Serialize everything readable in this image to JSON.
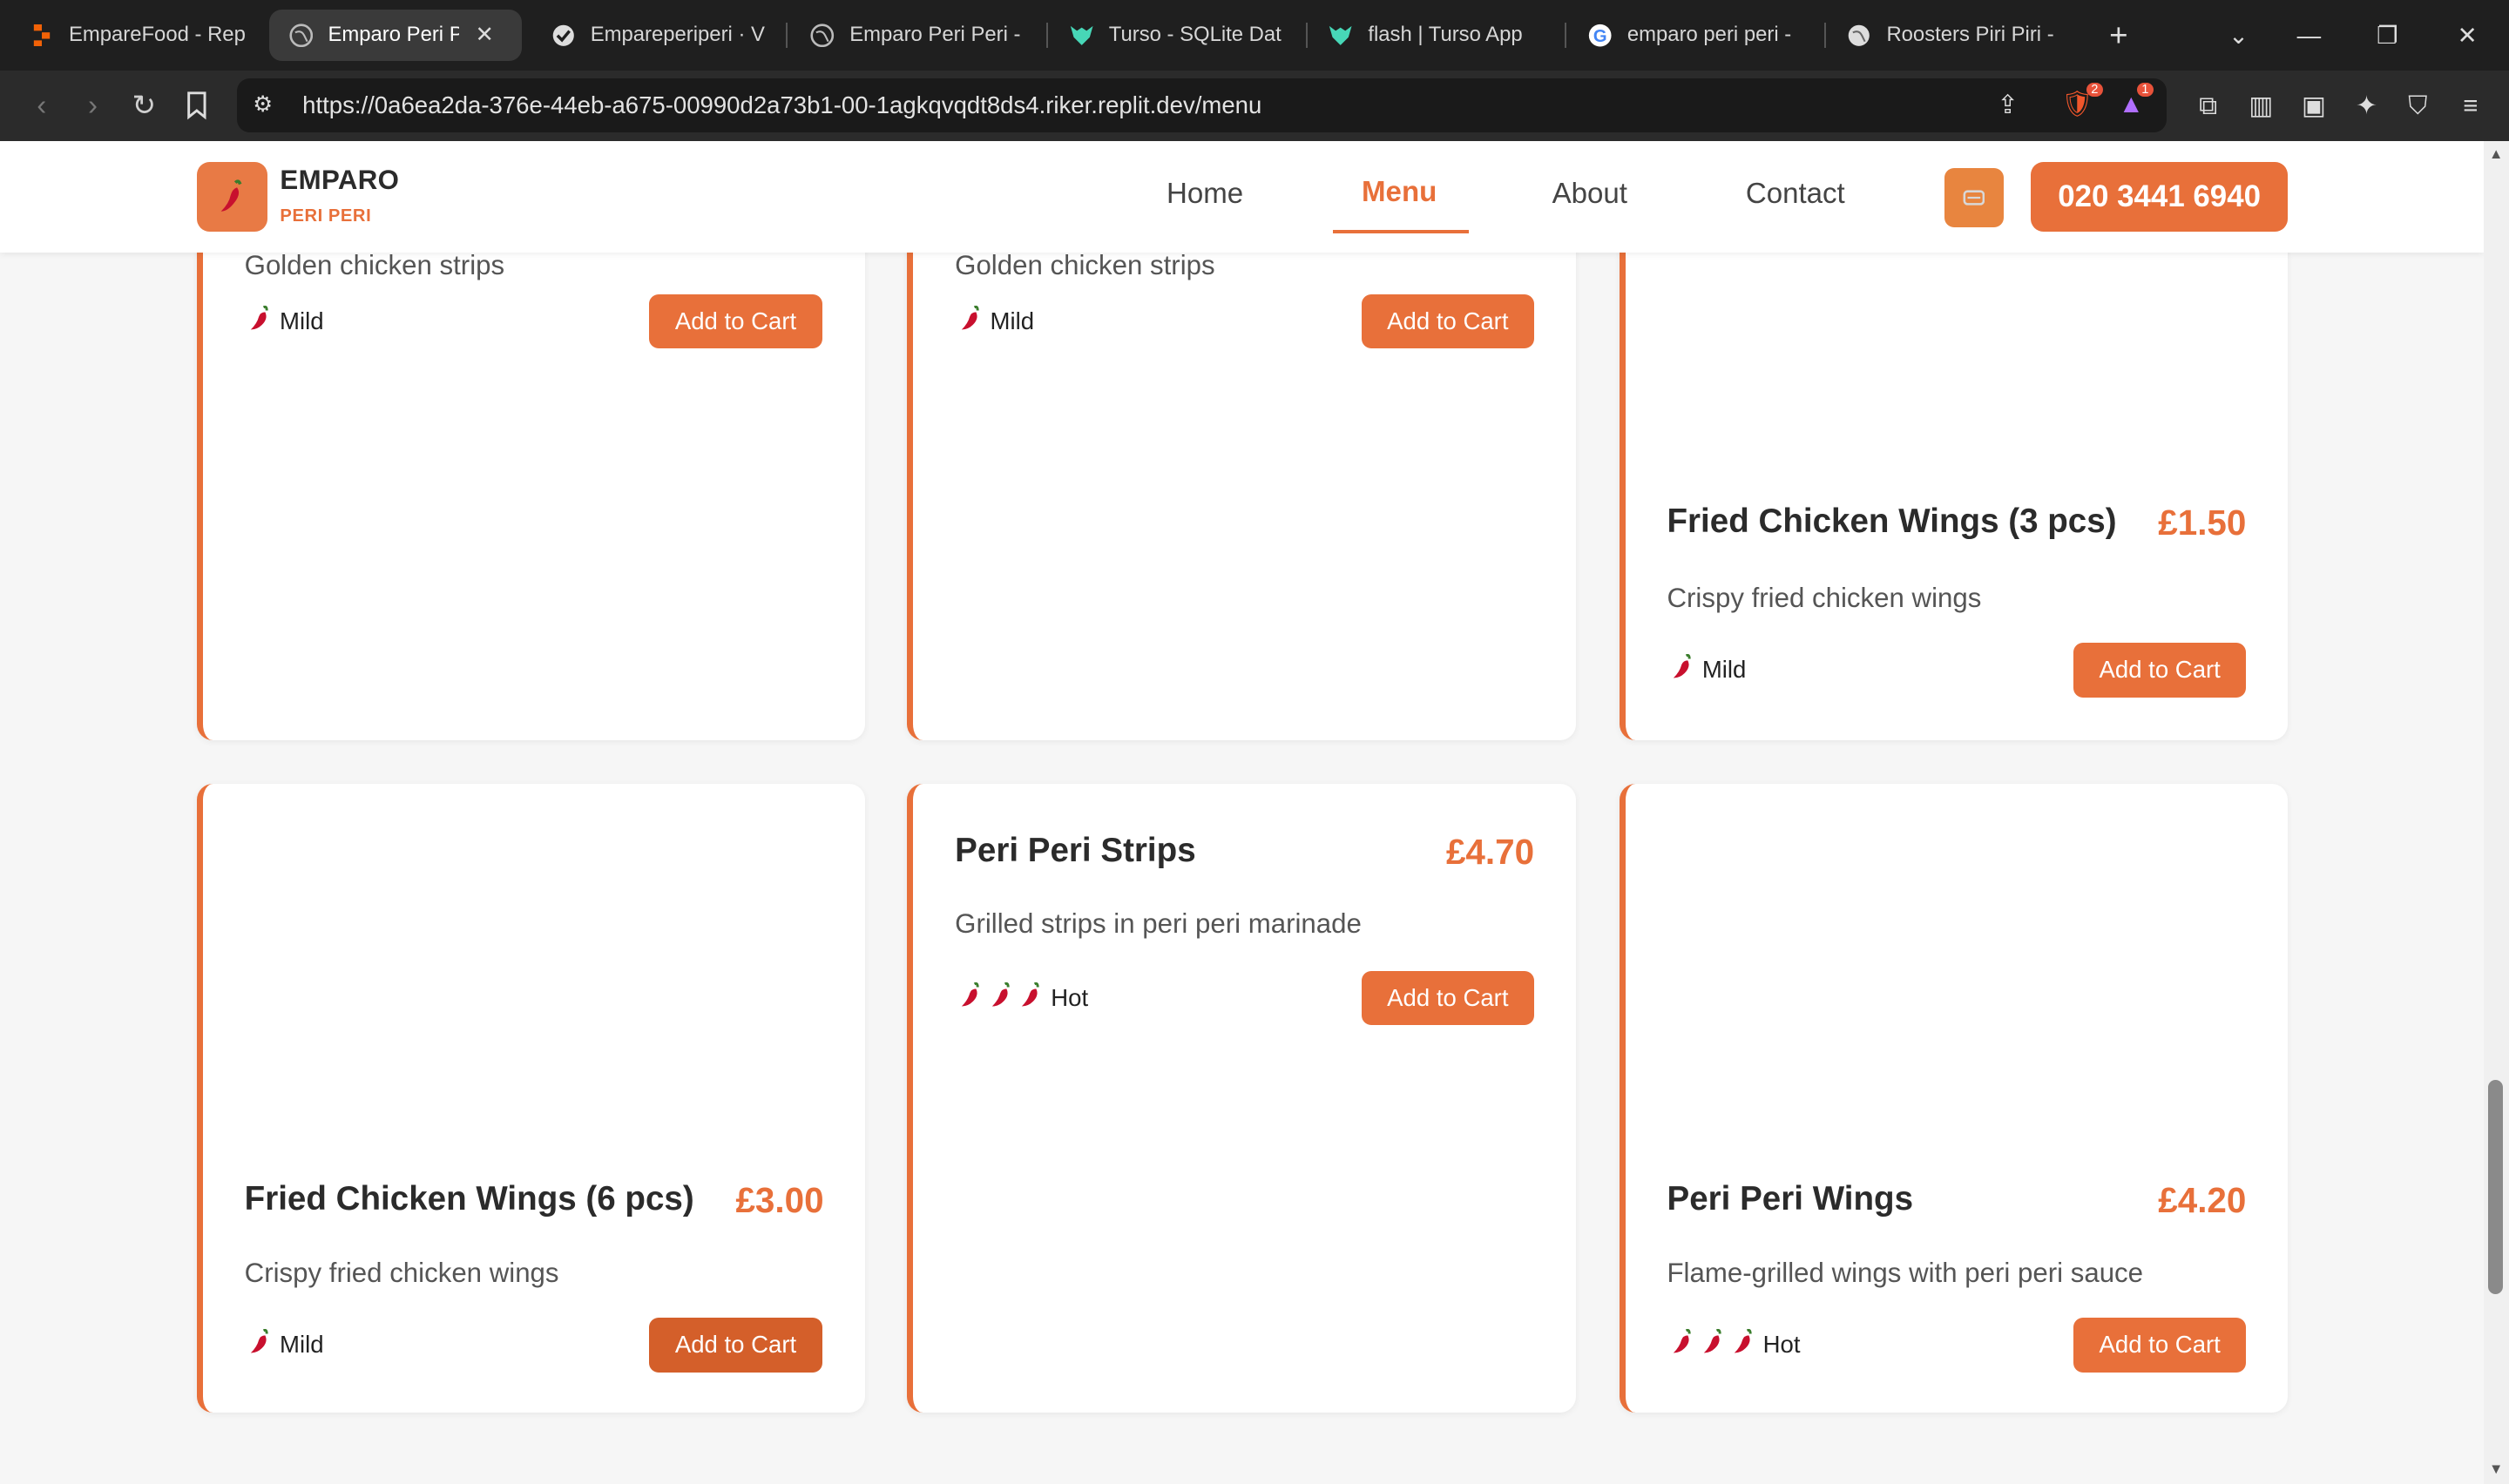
{
  "browser": {
    "tabs": [
      {
        "title": "EmpareFood - Rep",
        "icon": "replit-icon"
      },
      {
        "title": "Emparo Peri Pe",
        "icon": "globe-icon",
        "active": true
      },
      {
        "title": "Empareperiperi · V",
        "icon": "vercel-icon"
      },
      {
        "title": "Emparo Peri Peri -",
        "icon": "globe-icon"
      },
      {
        "title": "Turso - SQLite Dat",
        "icon": "turso-icon"
      },
      {
        "title": "flash | Turso App",
        "icon": "turso-icon"
      },
      {
        "title": "emparo peri peri -",
        "icon": "google-icon"
      },
      {
        "title": "Roosters Piri Piri -",
        "icon": "globe-icon"
      }
    ],
    "url": "https://0a6ea2da-376e-44eb-a675-00990d2a73b1-00-1agkqvqdt8ds4.riker.replit.dev/menu",
    "brave_shield_count": "2",
    "alert_count": "1"
  },
  "site": {
    "brand": "EMPARO",
    "brand_sub": "PERI PERI",
    "nav": [
      "Home",
      "Menu",
      "About",
      "Contact"
    ],
    "active_nav": "Menu",
    "phone": "020 3441 6940",
    "accent_color": "#e8703a"
  },
  "cards": [
    {
      "desc": "Golden chicken strips",
      "spice": "Mild",
      "chilis": 1,
      "button": "Add to Cart"
    },
    {
      "desc": "Golden chicken strips",
      "spice": "Mild",
      "chilis": 1,
      "button": "Add to Cart"
    },
    {
      "title": "Fried Chicken Wings (3 pcs)",
      "price": "£1.50",
      "desc": "Crispy fried chicken wings",
      "spice": "Mild",
      "chilis": 1,
      "button": "Add to Cart"
    },
    {
      "title": "Fried Chicken Wings (6 pcs)",
      "price": "£3.00",
      "desc": "Crispy fried chicken wings",
      "spice": "Mild",
      "chilis": 1,
      "button": "Add to Cart"
    },
    {
      "title": "Peri Peri Strips",
      "price": "£4.70",
      "desc": "Grilled strips in peri peri marinade",
      "spice": "Hot",
      "chilis": 3,
      "button": "Add to Cart"
    },
    {
      "title": "Peri Peri Wings",
      "price": "£4.20",
      "desc": "Flame-grilled wings with peri peri sauce",
      "spice": "Hot",
      "chilis": 3,
      "button": "Add to Cart"
    }
  ]
}
